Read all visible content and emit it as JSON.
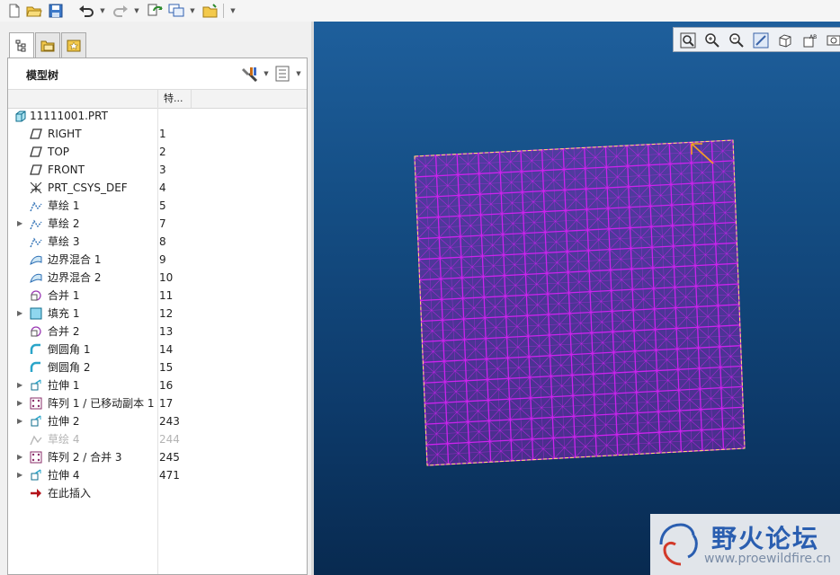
{
  "toolbar": {
    "buttons": [
      "new-icon",
      "open-icon",
      "save-icon",
      "undo-icon",
      "redo-icon",
      "regenerate-icon",
      "windows-icon",
      "close-window-icon",
      "customize-icon"
    ]
  },
  "panel": {
    "tabs": [
      "model-tree-icon",
      "folder-browser-icon",
      "favorites-icon"
    ],
    "title": "模型树",
    "col_header": "特..."
  },
  "tree": [
    {
      "label": "11111001.PRT",
      "num": "",
      "icon": "part-icon",
      "indent": 0,
      "expand": false,
      "dim": false
    },
    {
      "label": "RIGHT",
      "num": "1",
      "icon": "datum-plane-icon",
      "indent": 1,
      "expand": false,
      "dim": false
    },
    {
      "label": "TOP",
      "num": "2",
      "icon": "datum-plane-icon",
      "indent": 1,
      "expand": false,
      "dim": false
    },
    {
      "label": "FRONT",
      "num": "3",
      "icon": "datum-plane-icon",
      "indent": 1,
      "expand": false,
      "dim": false
    },
    {
      "label": "PRT_CSYS_DEF",
      "num": "4",
      "icon": "csys-icon",
      "indent": 1,
      "expand": false,
      "dim": false
    },
    {
      "label": "草绘 1",
      "num": "5",
      "icon": "sketch-icon",
      "indent": 1,
      "expand": false,
      "dim": false
    },
    {
      "label": "草绘 2",
      "num": "7",
      "icon": "sketch-icon",
      "indent": 1,
      "expand": true,
      "dim": false
    },
    {
      "label": "草绘 3",
      "num": "8",
      "icon": "sketch-icon",
      "indent": 1,
      "expand": false,
      "dim": false
    },
    {
      "label": "边界混合 1",
      "num": "9",
      "icon": "boundary-blend-icon",
      "indent": 1,
      "expand": false,
      "dim": false
    },
    {
      "label": "边界混合 2",
      "num": "10",
      "icon": "boundary-blend-icon",
      "indent": 1,
      "expand": false,
      "dim": false
    },
    {
      "label": "合并 1",
      "num": "11",
      "icon": "merge-icon",
      "indent": 1,
      "expand": false,
      "dim": false
    },
    {
      "label": "填充 1",
      "num": "12",
      "icon": "fill-icon",
      "indent": 1,
      "expand": true,
      "dim": false
    },
    {
      "label": "合并 2",
      "num": "13",
      "icon": "merge-icon",
      "indent": 1,
      "expand": false,
      "dim": false
    },
    {
      "label": "倒圆角 1",
      "num": "14",
      "icon": "round-icon",
      "indent": 1,
      "expand": false,
      "dim": false
    },
    {
      "label": "倒圆角 2",
      "num": "15",
      "icon": "round-icon",
      "indent": 1,
      "expand": false,
      "dim": false
    },
    {
      "label": "拉伸 1",
      "num": "16",
      "icon": "extrude-icon",
      "indent": 1,
      "expand": true,
      "dim": false
    },
    {
      "label": "阵列 1 / 已移动副本 1",
      "num": "17",
      "icon": "pattern-icon",
      "indent": 1,
      "expand": true,
      "dim": false
    },
    {
      "label": "拉伸 2",
      "num": "243",
      "icon": "extrude-icon",
      "indent": 1,
      "expand": true,
      "dim": false
    },
    {
      "label": "草绘 4",
      "num": "244",
      "icon": "sketch-hidden-icon",
      "indent": 1,
      "expand": false,
      "dim": true
    },
    {
      "label": "阵列 2 / 合并 3",
      "num": "245",
      "icon": "pattern-icon",
      "indent": 1,
      "expand": true,
      "dim": false
    },
    {
      "label": "拉伸 4",
      "num": "471",
      "icon": "extrude-icon",
      "indent": 1,
      "expand": true,
      "dim": false
    },
    {
      "label": "在此插入",
      "num": "",
      "icon": "insert-here-icon",
      "indent": 1,
      "expand": false,
      "dim": false
    }
  ],
  "view_toolbar": [
    "refit-icon",
    "zoom-in-icon",
    "zoom-out-icon",
    "repaint-icon",
    "saved-views-icon",
    "display-style-icon",
    "more-icon"
  ],
  "model": {
    "mesh_color": "#cc22ee",
    "edge_color": "#ffe26b",
    "grid_divisions": 15
  },
  "watermark": {
    "title": "野火论坛",
    "url": "www.proewildfire.cn"
  }
}
